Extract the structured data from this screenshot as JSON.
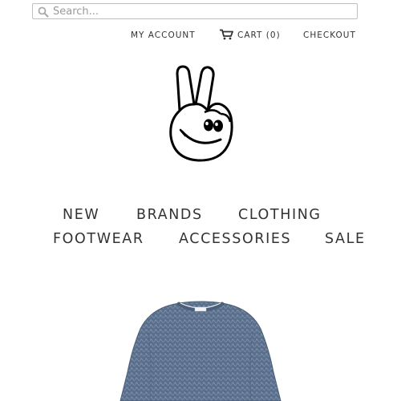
{
  "search": {
    "placeholder": "Search..."
  },
  "account_nav": {
    "my_account": "MY ACCOUNT",
    "cart": "CART (0)",
    "checkout": "CHECKOUT"
  },
  "main_nav": {
    "items": [
      "NEW",
      "BRANDS",
      "CLOTHING",
      "FOOTWEAR",
      "ACCESSORIES",
      "SALE"
    ]
  },
  "icons": {
    "search": "search-icon",
    "cart": "cart-icon",
    "logo": "peace-hand-logo"
  },
  "colors": {
    "text": "#333333",
    "sweater": "#5a6f8c"
  }
}
